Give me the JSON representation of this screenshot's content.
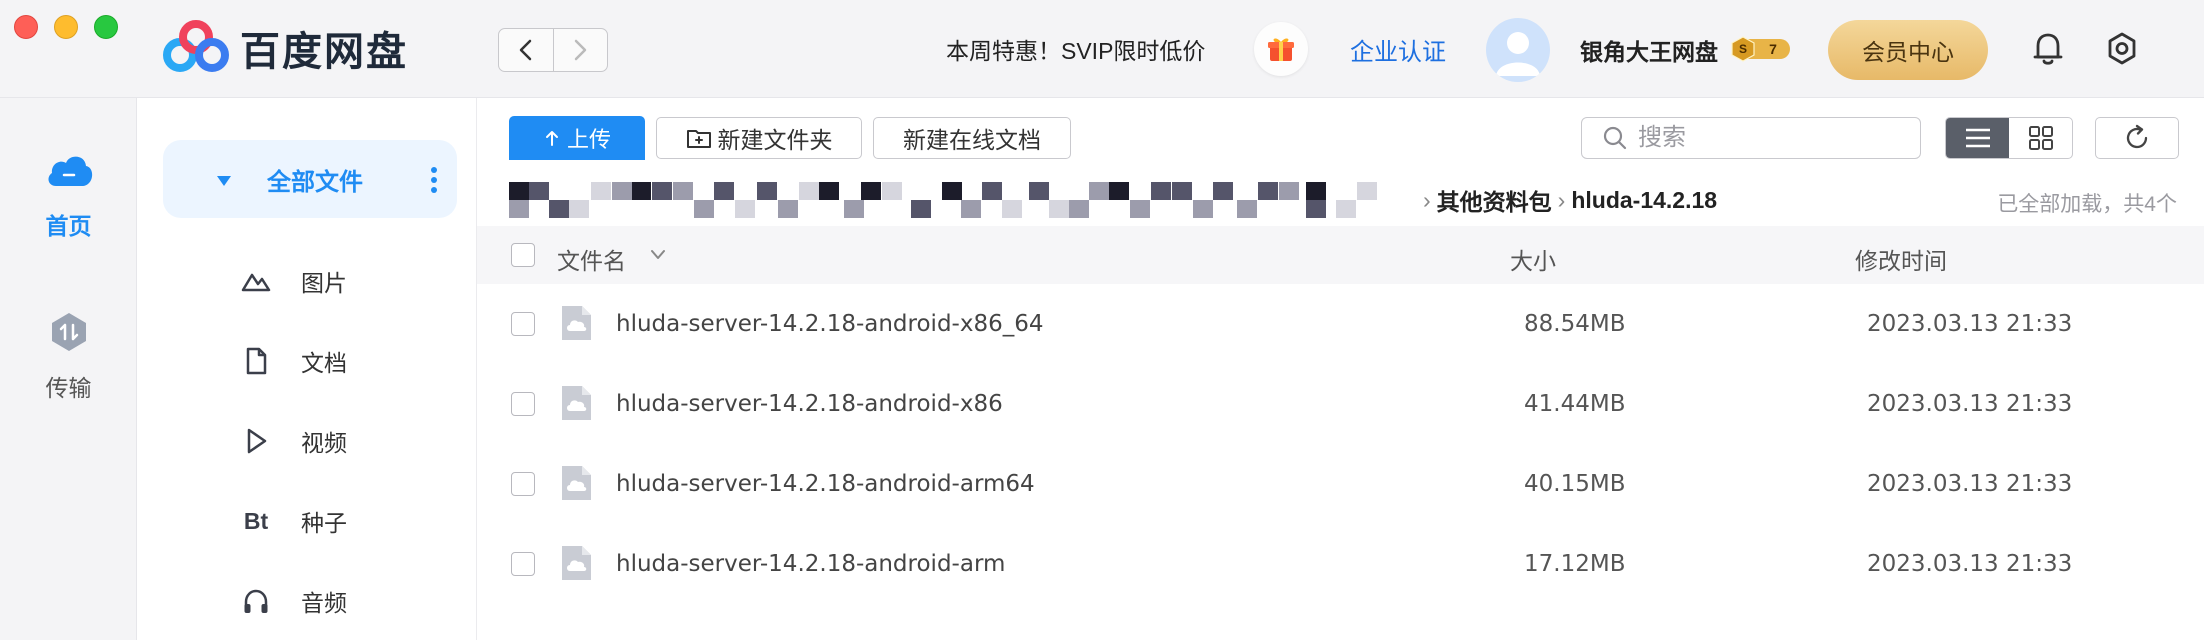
{
  "app": {
    "name": "百度网盘"
  },
  "header": {
    "promo": "本周特惠！SVIP限时低价",
    "enterprise_link": "企业认证",
    "username": "银角大王网盘",
    "vip_level": "7",
    "member_center": "会员中心"
  },
  "rail": {
    "items": [
      {
        "label": "首页",
        "icon": "cloud-icon",
        "active": true
      },
      {
        "label": "传输",
        "icon": "transfer-icon",
        "active": false
      }
    ]
  },
  "categories": {
    "all": "全部文件",
    "items": [
      {
        "label": "图片",
        "icon": "image-icon"
      },
      {
        "label": "文档",
        "icon": "document-icon"
      },
      {
        "label": "视频",
        "icon": "video-icon"
      },
      {
        "label": "种子",
        "icon": "torrent-icon",
        "glyph": "Bt"
      },
      {
        "label": "音频",
        "icon": "headphones-icon"
      }
    ]
  },
  "toolbar": {
    "upload": "上传",
    "new_folder": "新建文件夹",
    "new_online_doc": "新建在线文档",
    "search_placeholder": "搜索"
  },
  "breadcrumb": {
    "items": [
      "其他资料包",
      "hluda-14.2.18"
    ],
    "status": "已全部加载，共4个"
  },
  "table": {
    "columns": {
      "name": "文件名",
      "size": "大小",
      "modified": "修改时间"
    },
    "rows": [
      {
        "name": "hluda-server-14.2.18-android-x86_64",
        "size": "88.54MB",
        "modified": "2023.03.13 21:33"
      },
      {
        "name": "hluda-server-14.2.18-android-x86",
        "size": "41.44MB",
        "modified": "2023.03.13 21:33"
      },
      {
        "name": "hluda-server-14.2.18-android-arm64",
        "size": "40.15MB",
        "modified": "2023.03.13 21:33"
      },
      {
        "name": "hluda-server-14.2.18-android-arm",
        "size": "17.12MB",
        "modified": "2023.03.13 21:33"
      }
    ]
  },
  "colors": {
    "accent": "#1f8cf3",
    "member_gold": "#e7b968",
    "link": "#1d6fe0"
  }
}
